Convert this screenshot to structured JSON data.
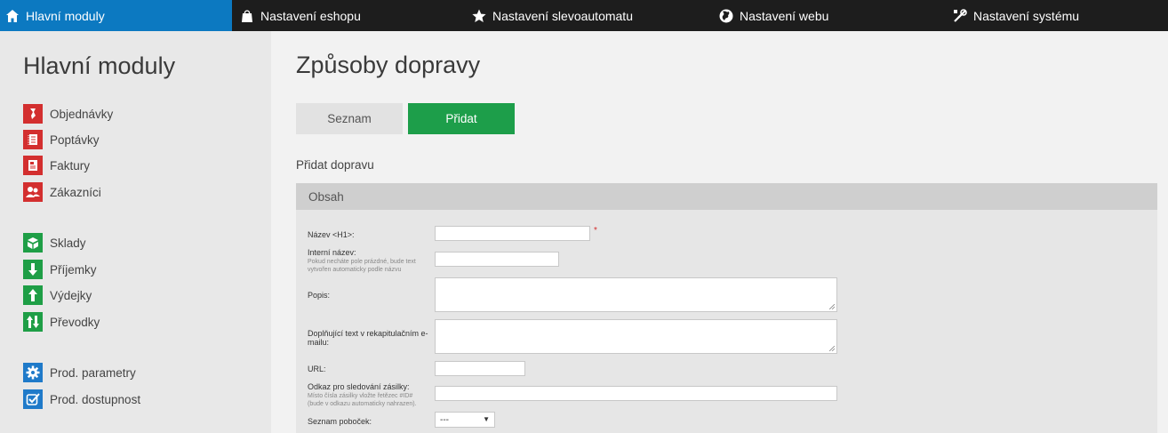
{
  "topnav": {
    "tabs": [
      {
        "label": "Hlavní moduly",
        "icon": "home-icon"
      },
      {
        "label": "Nastavení eshopu",
        "icon": "shopping-bag-icon"
      },
      {
        "label": "Nastavení slevoautomatu",
        "icon": "star-icon"
      },
      {
        "label": "Nastavení webu",
        "icon": "globe-icon"
      },
      {
        "label": "Nastavení systému",
        "icon": "tools-icon"
      }
    ]
  },
  "sidebar": {
    "title": "Hlavní moduly",
    "groups": [
      [
        {
          "label": "Objednávky",
          "icon": "orders-icon",
          "color": "#d32f2f"
        },
        {
          "label": "Poptávky",
          "icon": "inquiries-icon",
          "color": "#d32f2f"
        },
        {
          "label": "Faktury",
          "icon": "invoices-icon",
          "color": "#d32f2f"
        },
        {
          "label": "Zákazníci",
          "icon": "customers-icon",
          "color": "#d32f2f"
        }
      ],
      [
        {
          "label": "Sklady",
          "icon": "warehouse-icon",
          "color": "#1e9e46"
        },
        {
          "label": "Příjemky",
          "icon": "arrow-down-icon",
          "color": "#1e9e46"
        },
        {
          "label": "Výdejky",
          "icon": "arrow-up-icon",
          "color": "#1e9e46"
        },
        {
          "label": "Převodky",
          "icon": "transfer-icon",
          "color": "#1e9e46"
        }
      ],
      [
        {
          "label": "Prod. parametry",
          "icon": "gear-icon",
          "color": "#1f7ac9"
        },
        {
          "label": "Prod. dostupnost",
          "icon": "checkbox-icon",
          "color": "#1f7ac9"
        }
      ]
    ]
  },
  "main": {
    "title": "Způsoby dopravy",
    "buttons": {
      "list": "Seznam",
      "add": "Přidat"
    },
    "section_label": "Přidat dopravu",
    "panel_title": "Obsah",
    "form": {
      "name_label": "Název <H1>:",
      "required_mark": "*",
      "internal_name_label": "Interní název:",
      "internal_name_hint": "Pokud necháte pole prázdné, bude text vytvořen automaticky podle názvu",
      "description_label": "Popis:",
      "extra_text_label": "Doplňující text v rekapitulačním e-mailu:",
      "url_label": "URL:",
      "tracking_label": "Odkaz pro sledování zásilky:",
      "tracking_hint": "Místo čísla zásilky vložte řetězec #ID# (bude v odkazu automaticky nahrazen).",
      "branches_label": "Seznam poboček:",
      "branches_value": "---"
    }
  },
  "colors": {
    "accent": "#0c79c1",
    "topbar": "#1d1d1d",
    "add_button": "#1d9e4a",
    "red_icon": "#d32f2f",
    "green_icon": "#1e9e46",
    "blue_icon": "#1f7ac9"
  }
}
